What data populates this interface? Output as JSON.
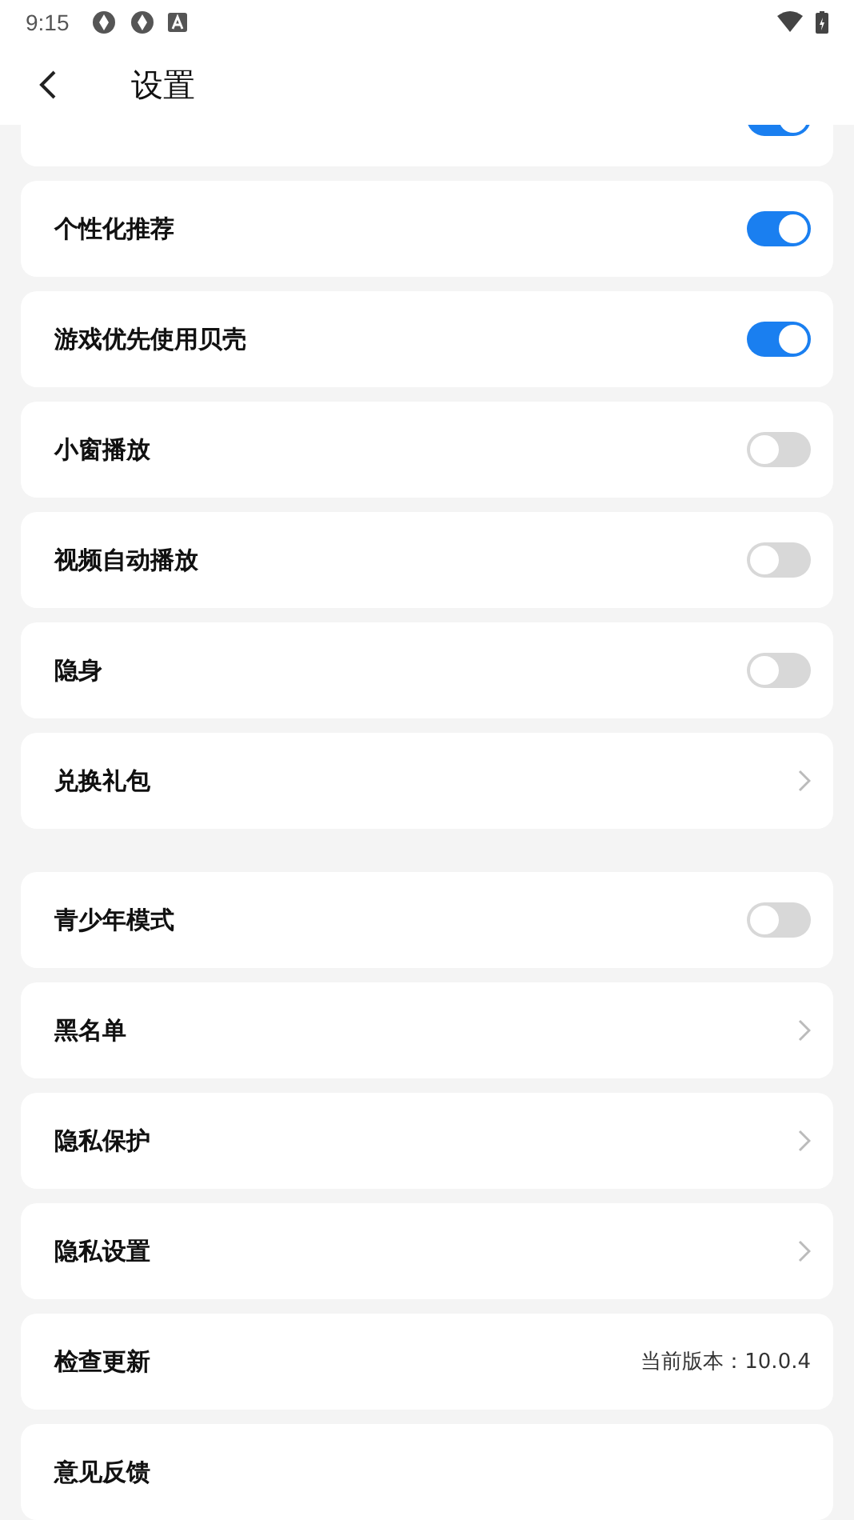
{
  "status_bar": {
    "time": "9:15"
  },
  "header": {
    "title": "设置"
  },
  "sections": [
    {
      "items": [
        {
          "kind": "toggle",
          "on": true
        },
        {
          "kind": "toggle",
          "label": "个性化推荐",
          "on": true
        },
        {
          "kind": "toggle",
          "label": "游戏优先使用贝壳",
          "on": true
        },
        {
          "kind": "toggle",
          "label": "小窗播放",
          "on": false
        },
        {
          "kind": "toggle",
          "label": "视频自动播放",
          "on": false
        },
        {
          "kind": "toggle",
          "label": "隐身",
          "on": false
        },
        {
          "kind": "link",
          "label": "兑换礼包"
        }
      ]
    },
    {
      "items": [
        {
          "kind": "toggle",
          "label": "青少年模式",
          "on": false
        },
        {
          "kind": "link",
          "label": "黑名单"
        },
        {
          "kind": "link",
          "label": "隐私保护"
        },
        {
          "kind": "link",
          "label": "隐私设置"
        },
        {
          "kind": "info",
          "label": "检查更新",
          "value": "当前版本：10.0.4"
        },
        {
          "kind": "plain",
          "label": "意见反馈"
        }
      ]
    }
  ]
}
